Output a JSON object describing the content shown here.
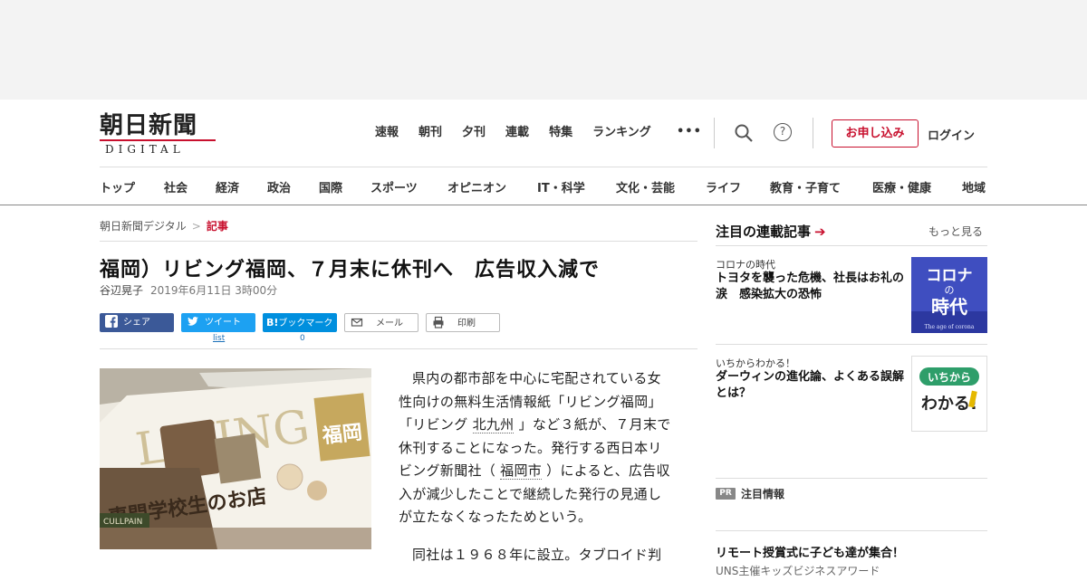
{
  "logo": {
    "main": "朝日新聞",
    "sub": "DIGITAL"
  },
  "topnav": [
    "速報",
    "朝刊",
    "夕刊",
    "連載",
    "特集",
    "ランキング"
  ],
  "more_dots": "•••",
  "header_buttons": {
    "help": "?",
    "subscribe": "お申し込み",
    "login": "ログイン"
  },
  "categories": [
    "トップ",
    "社会",
    "経済",
    "政治",
    "国際",
    "スポーツ",
    "オピニオン",
    "IT・科学",
    "文化・芸能",
    "ライフ",
    "教育・子育て",
    "医療・健康",
    "地域"
  ],
  "breadcrumb": {
    "home": "朝日新聞デジタル",
    "sep": ">",
    "current": "記事"
  },
  "article": {
    "title": "福岡）リビング福岡、７月末に休刊へ　広告収入減で",
    "author": "谷辺晃子",
    "date": "2019年6月11日 3時00分",
    "body": [
      {
        "pre": "県内の都市部を中心に宅配されている女性向けの無料生活情報紙「リビング福岡」「リビング ",
        "link1": "北九州",
        "mid": " 」など３紙が、７月末で休刊することになった。発行する西日本リビング新聞社（ ",
        "link2": "福岡市",
        "post": " ）によると、広告収入が減少したことで継続した発行の見通しが立たなくなったためという。"
      },
      {
        "text": "同社は１９６８年に設立。タブロイド判"
      }
    ]
  },
  "share": {
    "facebook": "シェア",
    "twitter": "ツイート",
    "hatena_mark": "B!",
    "hatena": "ブックマーク",
    "mail": "メール",
    "print": "印刷",
    "twitter_count": "list",
    "hatena_count": "0"
  },
  "photo": {
    "mag_title": "LIVING",
    "mag_city": "福岡",
    "headline": "専門学校生のお店",
    "corner_label": "CULLPAIN"
  },
  "sidebar": {
    "heading": "注目の連載記事",
    "more": "もっと見る",
    "items": [
      {
        "category": "コロナの時代",
        "title": "トヨタを襲った危機、社長はお礼の涙　感染拡大の恐怖",
        "thumb_line1": "コロナ",
        "thumb_line2": "の",
        "thumb_line3": "時代",
        "thumb_caption": "The age of corona"
      },
      {
        "category": "いちからわかる！",
        "title": "ダーウィンの進化論、よくある誤解とは？",
        "thumb_line1": "いちから",
        "thumb_line2": "わかる!"
      }
    ],
    "pr_badge": "PR",
    "pr_label": "注目情報",
    "pr_item_title": "リモート授賞式に子ども達が集合！",
    "pr_item_sub": "UNS主催キッズビジネスアワード"
  },
  "colors": {
    "brand_red": "#c8102e",
    "facebook": "#3b5998",
    "twitter": "#1da1f2",
    "hatena": "#008fde",
    "corona_bg": "#3f4ec0",
    "ichikara_bg": "#2e9e6a"
  }
}
